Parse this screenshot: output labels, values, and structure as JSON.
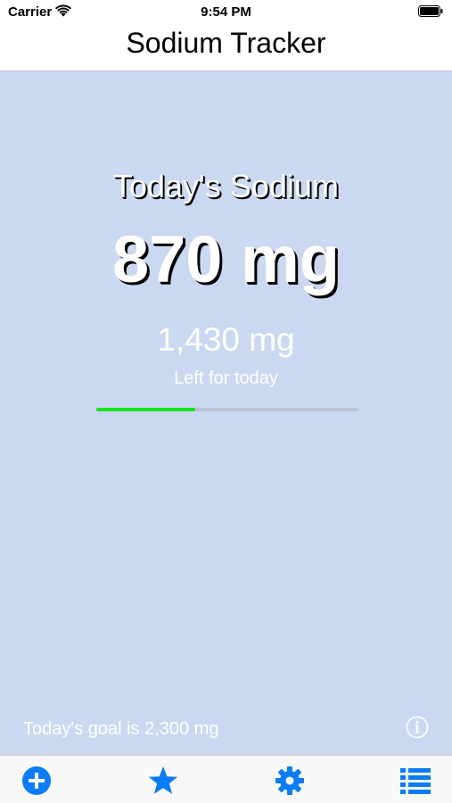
{
  "status_bar": {
    "carrier": "Carrier",
    "time": "9:54 PM"
  },
  "nav": {
    "title": "Sodium Tracker"
  },
  "summary": {
    "heading": "Today's Sodium",
    "amount": "870 mg",
    "remaining": "1,430 mg",
    "remaining_label": "Left for today",
    "progress_fraction": 0.378
  },
  "footer": {
    "goal_text": "Today's goal is 2,300 mg"
  },
  "tabs": [
    {
      "icon": "add-icon"
    },
    {
      "icon": "star-icon"
    },
    {
      "icon": "gear-icon"
    },
    {
      "icon": "list-icon"
    }
  ],
  "colors": {
    "accent": "#0a7cf6",
    "background": "#cad8f1",
    "progress": "#17e41c"
  }
}
